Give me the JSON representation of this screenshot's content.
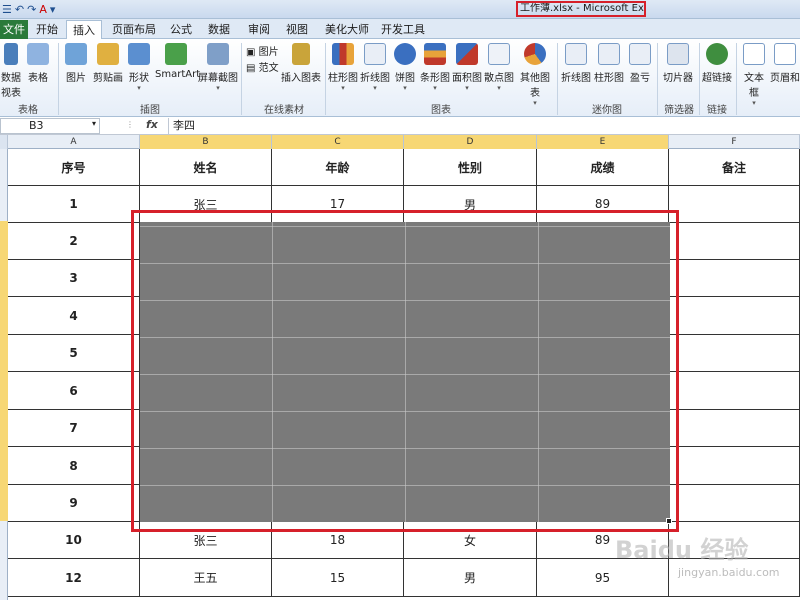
{
  "window": {
    "title": "工作薄.xlsx - Microsoft Excel",
    "qat": [
      "☰",
      "↶",
      "↷",
      "A",
      "▾"
    ]
  },
  "ribbon_tabs": [
    "文件",
    "开始",
    "插入",
    "页面布局",
    "公式",
    "数据",
    "审阅",
    "视图",
    "美化大师",
    "开发工具"
  ],
  "ribbon": {
    "tables": {
      "pivot": "数据\n视表",
      "table": "表格",
      "group": "表格"
    },
    "illustrations": {
      "picture": "图片",
      "clipart": "剪贴画",
      "shapes": "形状",
      "smartart": "SmartArt",
      "screenshot": "屏幕截图",
      "group": "插图"
    },
    "online": {
      "picture": "图片",
      "sample": "范文",
      "insert_chart": "插入图表",
      "group": "在线素材"
    },
    "charts": {
      "column": "柱形图",
      "line": "折线图",
      "pie": "饼图",
      "bar": "条形图",
      "area": "面积图",
      "scatter": "散点图",
      "other": "其他图表",
      "group": "图表"
    },
    "sparklines": {
      "line": "折线图",
      "column": "柱形图",
      "winloss": "盈亏",
      "group": "迷你图"
    },
    "filter": {
      "slicer": "切片器",
      "group": "筛选器"
    },
    "links": {
      "hyperlink": "超链接",
      "group": "链接"
    },
    "text": {
      "textbox": "文本框",
      "header": "页眉和"
    }
  },
  "formula_bar": {
    "name_box": "B3",
    "fx": "fx",
    "value": "李四"
  },
  "columns": [
    "A",
    "B",
    "C",
    "D",
    "E",
    "F"
  ],
  "table": {
    "headers": [
      "序号",
      "姓名",
      "年龄",
      "性别",
      "成绩",
      "备注"
    ],
    "rows": [
      [
        "1",
        "张三",
        "17",
        "男",
        "89",
        ""
      ],
      [
        "2",
        "",
        "",
        "",
        "",
        ""
      ],
      [
        "3",
        "",
        "",
        "",
        "",
        ""
      ],
      [
        "4",
        "",
        "",
        "",
        "",
        ""
      ],
      [
        "5",
        "",
        "",
        "",
        "",
        ""
      ],
      [
        "6",
        "",
        "",
        "",
        "",
        ""
      ],
      [
        "7",
        "",
        "",
        "",
        "",
        ""
      ],
      [
        "8",
        "",
        "",
        "",
        "",
        ""
      ],
      [
        "9",
        "",
        "",
        "",
        "",
        ""
      ],
      [
        "10",
        "张三",
        "18",
        "女",
        "89",
        ""
      ],
      [
        "12",
        "王五",
        "15",
        "男",
        "95",
        ""
      ]
    ]
  },
  "watermark": {
    "logo": "Baidu 经验",
    "url": "jingyan.baidu.com"
  },
  "colors": {
    "selection_border": "#d6202a",
    "file_tab": "#2a7a3a",
    "selected_header": "#f7d774"
  }
}
